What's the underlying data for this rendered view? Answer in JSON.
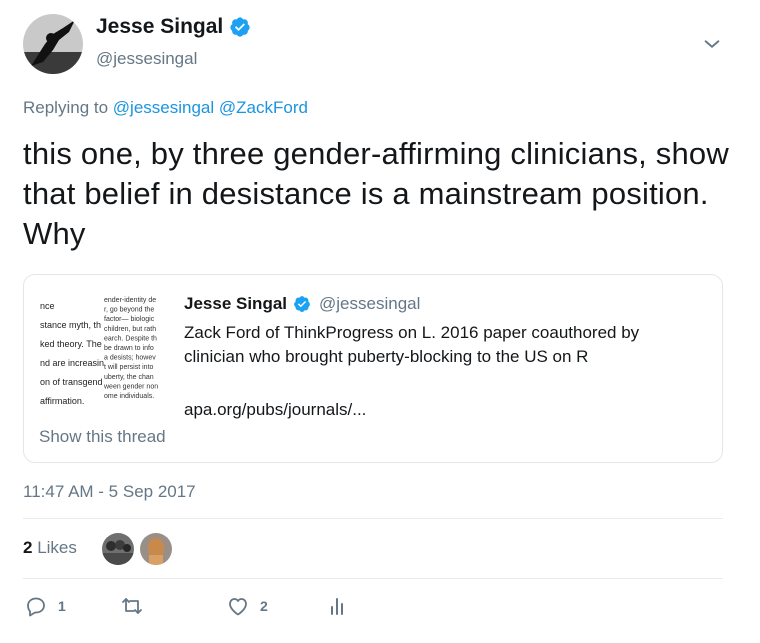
{
  "author": {
    "name": "Jesse Singal",
    "handle": "@jessesingal"
  },
  "reply": {
    "prefix": "Replying to",
    "mention1": "@jessesingal",
    "mention2": "@ZackFord"
  },
  "tweet": {
    "text": "this one, by three gender-affirming clinicians, show that belief in desistance is a mainstream position. Why"
  },
  "quote": {
    "name": "Jesse Singal",
    "handle": "@jessesingal",
    "text": "Zack Ford of ThinkProgress on L. 2016 paper coauthored by clinician who brought puberty-blocking to the US on R",
    "link": "apa.org/pubs/journals/...",
    "show_thread": "Show this thread",
    "thumb_lines_left": [
      "nce",
      "stance myth, th",
      "ked theory. The",
      "nd are increasin",
      "on of transgend",
      "affirmation."
    ],
    "thumb_lines_right": [
      "ender-identity de",
      "r, go beyond the",
      "factor— biologic",
      "children, but rath",
      "earch. Despite th",
      "be drawn to info",
      "a desists; howev",
      "t will persist into",
      "uberty, the chan",
      "ween gender non",
      "ome individuals."
    ]
  },
  "timestamp": "11:47 AM - 5 Sep 2017",
  "likes": {
    "count": "2",
    "label": "Likes"
  },
  "actions": {
    "reply_count": "1",
    "retweet_count": "",
    "like_count": "2"
  },
  "colors": {
    "link": "#1b95e0",
    "secondary": "#657786",
    "verified": "#1da1f2"
  }
}
